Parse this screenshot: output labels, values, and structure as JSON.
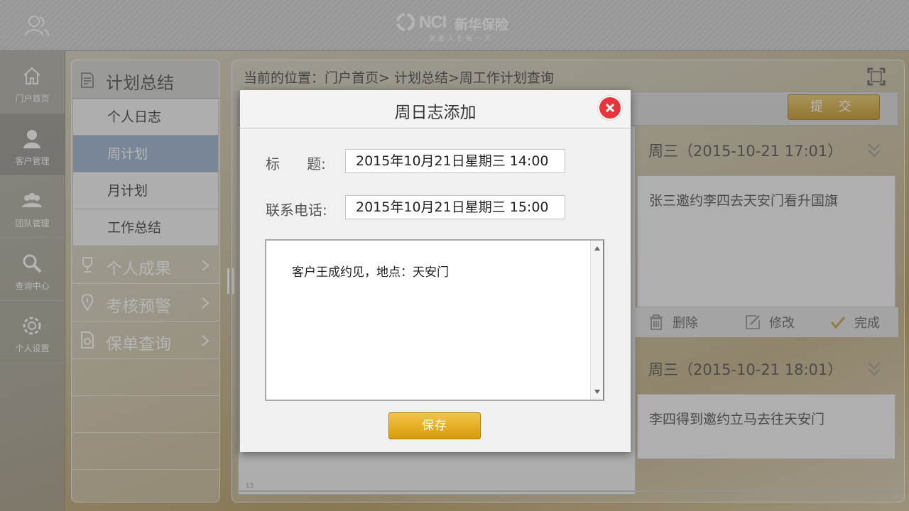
{
  "brand": {
    "logo_text": "NCI",
    "name": "新华保险",
    "slogan": "关爱人生每一天"
  },
  "leftnav": {
    "items": [
      {
        "label": "门户首页",
        "icon": "home-icon"
      },
      {
        "label": "客户管理",
        "icon": "customer-icon"
      },
      {
        "label": "团队管理",
        "icon": "team-icon"
      },
      {
        "label": "查询中心",
        "icon": "search-icon"
      },
      {
        "label": "个人设置",
        "icon": "gear-icon"
      }
    ]
  },
  "submenu": {
    "header": "计划总结",
    "items": [
      "个人日志",
      "周计划",
      "月计划",
      "工作总结"
    ],
    "groups": [
      "个人成果",
      "考核预警",
      "保单查询"
    ]
  },
  "main": {
    "breadcrumb": "当前的位置：门户首页> 计划总结>周工作计划查询",
    "submit_label": "提 交",
    "calendar_tick": "15",
    "events": [
      {
        "title": "周三（2015-10-21  17:01）",
        "desc": "张三邀约李四去天安门看升国旗"
      },
      {
        "title": "周三（2015-10-21  18:01）",
        "desc": "李四得到邀约立马去往天安门"
      }
    ],
    "actions": {
      "delete": "删除",
      "edit": "修改",
      "done": "完成"
    }
  },
  "modal": {
    "title": "周日志添加",
    "title_label": "标      题:",
    "title_value": "2015年10月21日星期三    14:00",
    "phone_label": "联系电话:",
    "phone_value": "2015年10月21日星期三    15:00",
    "content": "客户王成约见，地点：天安门",
    "save_label": "保存"
  },
  "colors": {
    "accent_gold": "#d99a06",
    "close_red": "#e8343c",
    "selected_blue": "#9fb4d0"
  }
}
